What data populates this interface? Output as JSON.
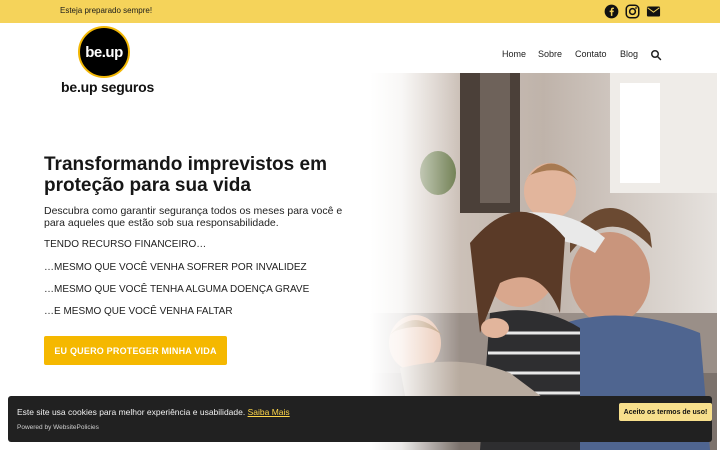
{
  "topbar": {
    "tagline": "Esteja preparado sempre!",
    "social": [
      {
        "icon": "facebook-icon"
      },
      {
        "icon": "instagram-icon"
      },
      {
        "icon": "envelope-icon"
      }
    ]
  },
  "header": {
    "logo_badge": "be.up",
    "logo_text": "be.up seguros",
    "nav": [
      "Home",
      "Sobre",
      "Contato",
      "Blog"
    ],
    "search_icon": "search-icon"
  },
  "hero": {
    "title": "Transformando imprevistos em proteção para sua vida",
    "subtitle": "Descubra como garantir segurança todos os meses para você e para aqueles que estão sob sua responsabilidade.",
    "lines": [
      "TENDO RECURSO FINANCEIRO…",
      "…MESMO QUE VOCÊ VENHA SOFRER POR INVALIDEZ",
      "…MESMO QUE VOCÊ TENHA ALGUMA DOENÇA GRAVE",
      "…E MESMO QUE VOCÊ VENHA FALTAR"
    ],
    "cta": "EU QUERO PROTEGER MINHA VIDA"
  },
  "cookie": {
    "message": "Este site usa cookies para melhor experiência e usabilidade.",
    "link": "Saiba Mais",
    "powered": "Powered by WebsitePolicies",
    "accept": "Aceito os termos de uso!"
  },
  "colors": {
    "accent": "#f5d35a",
    "cta": "#f5b800",
    "banner": "#212121"
  }
}
